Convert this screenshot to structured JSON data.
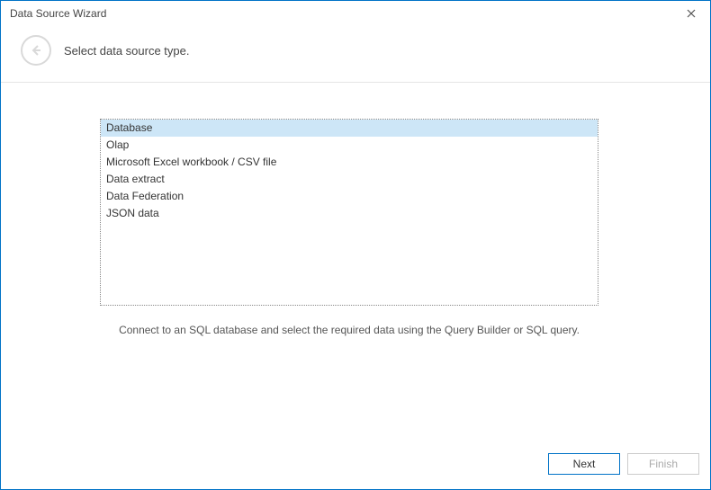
{
  "window": {
    "title": "Data Source Wizard"
  },
  "header": {
    "instruction": "Select data source type."
  },
  "list": {
    "items": [
      {
        "label": "Database",
        "selected": true
      },
      {
        "label": "Olap",
        "selected": false
      },
      {
        "label": "Microsoft Excel workbook / CSV file",
        "selected": false
      },
      {
        "label": "Data extract",
        "selected": false
      },
      {
        "label": "Data Federation",
        "selected": false
      },
      {
        "label": "JSON data",
        "selected": false
      }
    ]
  },
  "description": "Connect to an SQL database and select the required data using the Query Builder or SQL query.",
  "footer": {
    "next_label": "Next",
    "finish_label": "Finish"
  }
}
